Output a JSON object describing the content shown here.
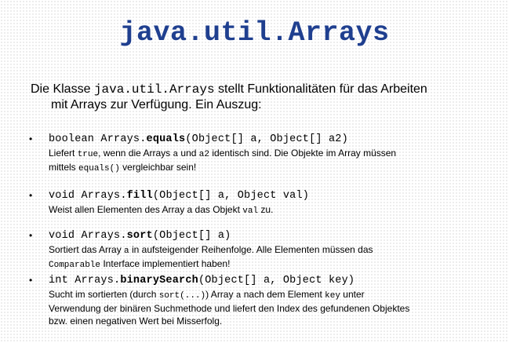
{
  "title": "java.util.Arrays",
  "intro": {
    "pre": "Die Klasse ",
    "class_name": "java.util.Arrays",
    "post1": " stellt Funktionalitäten für das Arbeiten",
    "line2": "mit Arrays zur Verfügung. Ein Auszug:"
  },
  "bullet_char": "•",
  "items": [
    {
      "sig_pre": "boolean Arrays.",
      "sig_method": "equals",
      "sig_post": "(Object[] a, Object[] a2)",
      "line1": [
        {
          "t": "Liefert "
        },
        {
          "t": "true",
          "m": true
        },
        {
          "t": ", wenn die Arrays "
        },
        {
          "t": "a",
          "m": true
        },
        {
          "t": " und "
        },
        {
          "t": "a2",
          "m": true
        },
        {
          "t": " identisch sind. Die Objekte im Array müssen"
        }
      ],
      "line2": [
        {
          "t": "mittels "
        },
        {
          "t": "equals()",
          "m": true
        },
        {
          "t": " vergleichbar sein!"
        }
      ]
    },
    {
      "sig_pre": "void Arrays.",
      "sig_method": "fill",
      "sig_post": "(Object[] a, Object val)",
      "line1": [
        {
          "t": "Weist allen Elementen des Array a das Objekt "
        },
        {
          "t": "val",
          "m": true
        },
        {
          "t": " zu."
        }
      ]
    },
    {
      "sig_pre": "void Arrays.",
      "sig_method": "sort",
      "sig_post": "(Object[] a)",
      "line1": [
        {
          "t": "Sortiert das Array "
        },
        {
          "t": "a",
          "m": true
        },
        {
          "t": "  in aufsteigender Reihenfolge. Alle Elementen müssen das"
        }
      ],
      "line2": [
        {
          "t": "Comparable",
          "m": true
        },
        {
          "t": " Interface  implementiert haben!"
        }
      ]
    },
    {
      "sig_pre": "int Arrays.",
      "sig_method": "binarySearch",
      "sig_post": "(Object[] a, Object key)",
      "line1": [
        {
          "t": "Sucht im sortierten (durch "
        },
        {
          "t": "sort(...)",
          "m": true
        },
        {
          "t": ") Array "
        },
        {
          "t": "a",
          "m": true
        },
        {
          "t": " nach dem Element "
        },
        {
          "t": "key",
          "m": true
        },
        {
          "t": " unter"
        }
      ],
      "line2": [
        {
          "t": "Verwendung der binären Suchmethode und liefert den Index des gefundenen Objektes"
        }
      ],
      "line3": [
        {
          "t": "bzw. einen negativen Wert bei Misserfolg."
        }
      ]
    }
  ]
}
